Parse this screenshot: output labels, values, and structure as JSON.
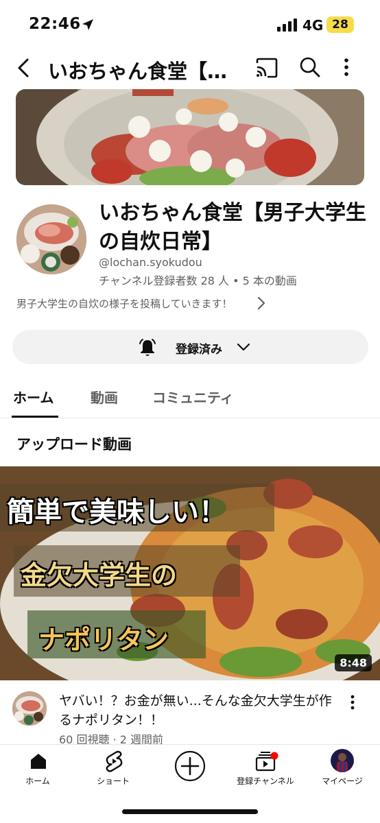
{
  "status_bar": {
    "time": "22:46",
    "network": "4G",
    "battery": "28"
  },
  "app_bar": {
    "title": "いおちゃん食堂【…"
  },
  "channel": {
    "name": "いおちゃん食堂【男子大学生の自炊日常】",
    "handle": "@lochan.syokudou",
    "stats": "チャンネル登録者数 28 人 • 5 本の動画",
    "description": "男子大学生の自炊の様子を投稿していきます！"
  },
  "subscribe": {
    "label": "登録済み"
  },
  "tabs": [
    {
      "label": "ホーム"
    },
    {
      "label": "動画"
    },
    {
      "label": "コミュニティ"
    }
  ],
  "section": {
    "title": "アップロード動画"
  },
  "video": {
    "thumbnail_text": [
      "簡単で美味しい！",
      "金欠大学生の",
      "ナポリタン"
    ],
    "duration": "8:48",
    "title": "ヤバい！？お金が無い...そんな金欠大学生が作るナポリタン！！",
    "meta": "60 回視聴 · 2 週間前"
  },
  "bottom_nav": [
    {
      "label": "ホーム",
      "icon": "home-icon"
    },
    {
      "label": "ショート",
      "icon": "shorts-icon"
    },
    {
      "label": "",
      "icon": "create-icon"
    },
    {
      "label": "登録チャンネル",
      "icon": "subscriptions-icon"
    },
    {
      "label": "マイページ",
      "icon": "profile-avatar"
    }
  ],
  "colors": {
    "text_primary": "#0f0f0f",
    "text_secondary": "#606060",
    "button_bg": "#f2f2f2",
    "notification_dot": "#ff0000",
    "battery": "#f7dc4a"
  }
}
